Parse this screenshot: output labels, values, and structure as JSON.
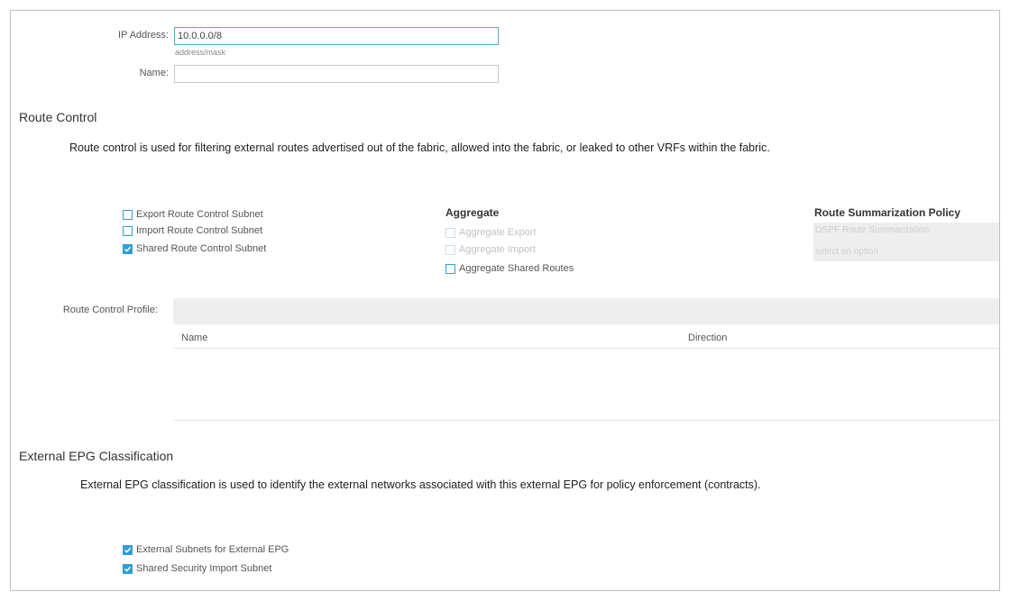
{
  "form": {
    "ip_address_label": "IP Address:",
    "ip_address_value": "10.0.0.0/8",
    "ip_address_hint": "address/mask",
    "name_label": "Name:",
    "name_value": ""
  },
  "route_control": {
    "title": "Route Control",
    "description": "Route control is used for filtering external routes advertised out of the fabric, allowed into the fabric, or leaked to other VRFs within the fabric.",
    "checkboxes": [
      {
        "label": "Export Route Control Subnet",
        "checked": false
      },
      {
        "label": "Import Route Control Subnet",
        "checked": false
      },
      {
        "label": "Shared Route Control Subnet",
        "checked": true
      }
    ],
    "aggregate": {
      "title": "Aggregate",
      "checkboxes": [
        {
          "label": "Aggregate Export",
          "checked": false,
          "disabled": true
        },
        {
          "label": "Aggregate Import",
          "checked": false,
          "disabled": true
        },
        {
          "label": "Aggregate Shared Routes",
          "checked": false,
          "disabled": false
        }
      ]
    },
    "summarization": {
      "title": "Route Summarization Policy",
      "field_label": "OSPF Route Summarization:",
      "placeholder": "select an option"
    },
    "profile": {
      "label": "Route Control Profile:",
      "columns": [
        "Name",
        "Direction"
      ],
      "rows": []
    }
  },
  "external_epg": {
    "title": "External EPG Classification",
    "description": "External EPG classification is used to identify the external networks associated with this external EPG for policy enforcement (contracts).",
    "checkboxes": [
      {
        "label": "External Subnets for External EPG",
        "checked": true
      },
      {
        "label": "Shared Security Import Subnet",
        "checked": true
      }
    ]
  },
  "colors": {
    "accent": "#2f9ed6",
    "focus_border": "#5ba8c9",
    "grey_panel": "#eeeeee"
  }
}
